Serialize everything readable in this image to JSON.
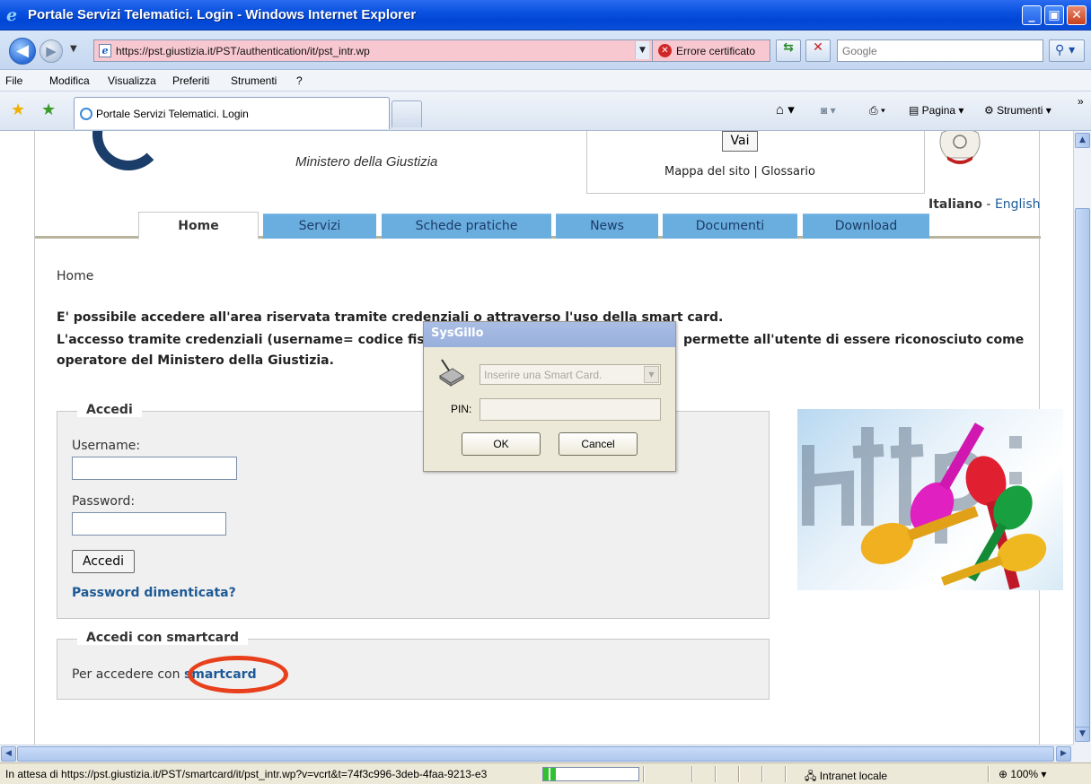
{
  "window": {
    "title": "Portale Servizi Telematici. Login - Windows Internet Explorer",
    "minimize": "_",
    "maximize": "▣",
    "close": "✕"
  },
  "addressbar": {
    "url": "https://pst.giustizia.it/PST/authentication/it/pst_intr.wp",
    "cert_error": "Errore certificato",
    "search_placeholder": "Google"
  },
  "menubar": {
    "items": [
      "File",
      "Modifica",
      "Visualizza",
      "Preferiti",
      "Strumenti",
      "?"
    ]
  },
  "tabbar": {
    "active_tab": "Portale Servizi Telematici. Login",
    "commands": {
      "pagina": "Pagina",
      "strumenti": "Strumenti"
    }
  },
  "site": {
    "ministero": "Ministero della Giustizia",
    "vai": "Vai",
    "mappa": "Mappa del sito",
    "glossario": "Glossario",
    "lang_it": "Italiano",
    "lang_sep": " - ",
    "lang_en": "English",
    "nav": [
      "Home",
      "Servizi",
      "Schede pratiche",
      "News",
      "Documenti",
      "Download"
    ]
  },
  "content": {
    "breadcrumb": "Home",
    "intro1": "E' possibile accedere all'area riservata tramite credenziali o attraverso l'uso della smart card.",
    "intro2a": "L'accesso tramite credenziali (username= codice fiscale",
    "intro2b": "permette all'utente di essere riconosciuto come",
    "intro3": "operatore del Ministero della Giustizia.",
    "login": {
      "legend": "Accedi",
      "username_label": "Username:",
      "password_label": "Password:",
      "button": "Accedi",
      "forgot": "Password dimenticata?"
    },
    "smartcard": {
      "legend": "Accedi con smartcard",
      "text": "Per accedere con",
      "link": "smartcard"
    }
  },
  "dialog": {
    "title": "SysGillo",
    "card_select": "Inserire una Smart Card.",
    "pin_label": "PIN:",
    "ok": "OK",
    "cancel": "Cancel"
  },
  "statusbar": {
    "text": "In attesa di https://pst.giustizia.it/PST/smartcard/it/pst_intr.wp?v=vcrt&t=74f3c996-3deb-4faa-9213-e3",
    "zone": "Intranet locale",
    "zoom": "100%",
    "progress": 0.13
  }
}
